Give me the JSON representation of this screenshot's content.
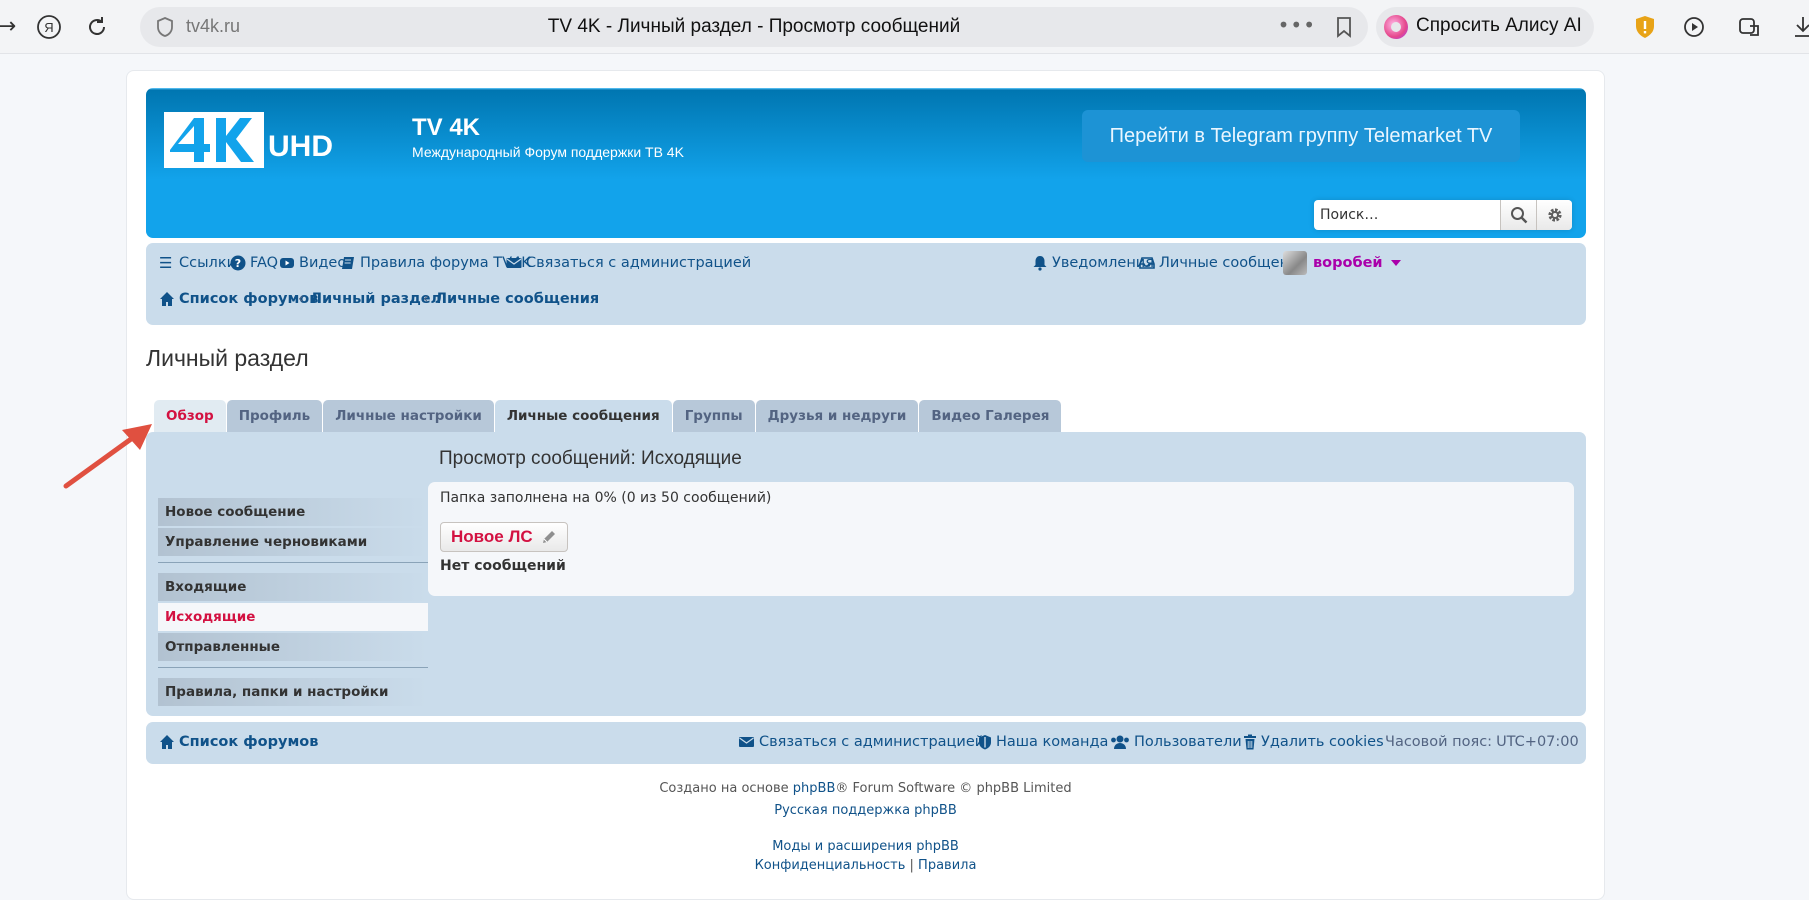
{
  "browser": {
    "domain": "tv4k.ru",
    "tab_title": "TV 4K - Личный раздел - Просмотр сообщений",
    "alice_label": "Спросить Алису AI"
  },
  "header": {
    "logo_text": "UHD",
    "site_title": "TV 4K",
    "site_desc": "Международный Форум поддержки ТВ 4K",
    "telegram_button": "Перейти в Telegram группу Telemarket TV",
    "search_placeholder": "Поиск…"
  },
  "navbar": {
    "links": [
      {
        "label": "Ссылки",
        "icon": "bars-icon"
      },
      {
        "label": "FAQ",
        "icon": "question-circle-icon"
      },
      {
        "label": "Видео",
        "icon": "youtube-icon"
      },
      {
        "label": "Правила форума TV4K",
        "icon": "book-icon"
      },
      {
        "label": "Связаться с администрацией",
        "icon": "envelope-icon"
      }
    ],
    "notifications": "Уведомления",
    "private_messages": "Личные сообщения",
    "username": "воробей",
    "breadcrumbs": [
      "Список форумов",
      "Личный раздел",
      "Личные сообщения"
    ]
  },
  "page_title": "Личный раздел",
  "tabs": [
    "Обзор",
    "Профиль",
    "Личные настройки",
    "Личные сообщения",
    "Группы",
    "Друзья и недруги",
    "Видео Галерея"
  ],
  "sidebar": {
    "group1": [
      "Новое сообщение",
      "Управление черновиками"
    ],
    "group2": [
      "Входящие",
      "Исходящие",
      "Отправленные"
    ],
    "group3": [
      "Правила, папки и настройки"
    ]
  },
  "main": {
    "title": "Просмотр сообщений: Исходящие",
    "folder_status": "Папка заполнена на 0% (0 из 50 сообщений)",
    "new_pm_button": "Новое ЛС",
    "no_messages": "Нет сообщений"
  },
  "footer": {
    "board_index": "Список форумов",
    "contact": "Связаться с администрацией",
    "team": "Наша команда",
    "members": "Пользователи",
    "delete_cookies": "Удалить cookies",
    "timezone_label": "Часовой пояс:",
    "timezone_value": "UTC+07:00",
    "created_prefix": "Создано на основе",
    "phpbb": "phpBB",
    "created_suffix": "® Forum Software © phpBB Limited",
    "russian_support": "Русская поддержка phpBB",
    "mods": "Моды и расширения phpBB",
    "privacy": "Конфиденциальность",
    "separator": "|",
    "terms": "Правила"
  },
  "colors": {
    "header_blue": "#12A3EB",
    "nav_bg": "#cadceb",
    "link": "#105289",
    "active_red": "#d31141",
    "username": "#aa00aa",
    "arrow": "#e05040"
  }
}
